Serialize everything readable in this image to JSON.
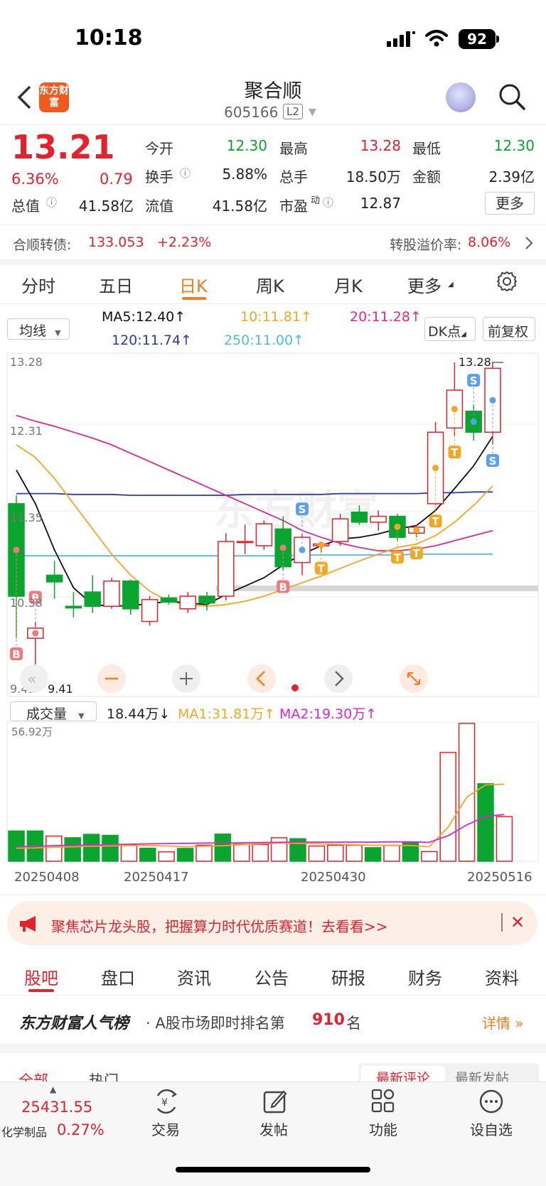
{
  "status": {
    "time": "10:18",
    "battery": "92"
  },
  "header": {
    "logo": "东方财富",
    "name": "聚合顺",
    "code": "605166",
    "level": "L2"
  },
  "quote": {
    "price": "13.21",
    "change_pct": "6.36%",
    "change": "0.79",
    "open_label": "今开",
    "open": "12.30",
    "high_label": "最高",
    "high": "13.28",
    "low_label": "最低",
    "low": "12.30",
    "turnover_label": "换手",
    "turnover": "5.88%",
    "volume_label": "总手",
    "volume": "18.50万",
    "amount_label": "金额",
    "amount": "2.39亿",
    "mktcap_label": "总值",
    "mktcap": "41.58亿",
    "float_label": "流值",
    "float": "41.58亿",
    "pe_label": "市盈",
    "pe_sup": "动",
    "pe": "12.87",
    "more": "更多"
  },
  "bond": {
    "label": "合顺转债:",
    "price": "133.053",
    "change": "+2.23%",
    "premium_label": "转股溢价率:",
    "premium": "8.06%"
  },
  "tabs": [
    "分时",
    "五日",
    "日K",
    "周K",
    "月K",
    "更多"
  ],
  "ma_row": {
    "selector": "均线",
    "ma5": "MA5:12.40↑",
    "ma10": "10:11.81↑",
    "ma20": "20:11.28↑",
    "ma120": "120:11.74↑",
    "ma250": "250:11.00↑",
    "dk": "DK点",
    "fq": "前复权"
  },
  "chart_labels": {
    "hi_axis": "13.28",
    "mid1": "12.31",
    "mid2": "11.35",
    "mid3": "10.38",
    "lo_axis": "9.41",
    "hi_mark": "13.28",
    "lo_mark": "9.41"
  },
  "watermark": "东方财富",
  "chart_data": [
    {
      "type": "candlestick",
      "y_range": [
        9.41,
        13.28
      ],
      "candles": [
        {
          "o": 11.6,
          "h": 11.7,
          "l": 10.0,
          "c": 10.5
        },
        {
          "o": 10.0,
          "h": 10.2,
          "l": 9.41,
          "c": 10.12
        },
        {
          "o": 10.75,
          "h": 10.92,
          "l": 10.47,
          "c": 10.67
        },
        {
          "o": 10.38,
          "h": 10.55,
          "l": 10.25,
          "c": 10.36
        },
        {
          "o": 10.55,
          "h": 10.75,
          "l": 10.3,
          "c": 10.38
        },
        {
          "o": 10.38,
          "h": 10.72,
          "l": 10.35,
          "c": 10.68
        },
        {
          "o": 10.68,
          "h": 10.7,
          "l": 10.28,
          "c": 10.35
        },
        {
          "o": 10.2,
          "h": 10.5,
          "l": 10.15,
          "c": 10.46
        },
        {
          "o": 10.48,
          "h": 10.52,
          "l": 10.4,
          "c": 10.43
        },
        {
          "o": 10.35,
          "h": 10.55,
          "l": 10.3,
          "c": 10.5
        },
        {
          "o": 10.5,
          "h": 10.55,
          "l": 10.33,
          "c": 10.42
        },
        {
          "o": 10.5,
          "h": 11.25,
          "l": 10.45,
          "c": 11.15
        },
        {
          "o": 11.15,
          "h": 11.35,
          "l": 11.0,
          "c": 11.15
        },
        {
          "o": 11.1,
          "h": 11.4,
          "l": 11.05,
          "c": 11.36
        },
        {
          "o": 11.3,
          "h": 11.45,
          "l": 10.8,
          "c": 10.85
        },
        {
          "o": 10.9,
          "h": 11.25,
          "l": 10.75,
          "c": 11.2
        },
        {
          "o": 11.1,
          "h": 11.15,
          "l": 11.02,
          "c": 11.12
        },
        {
          "o": 11.15,
          "h": 11.48,
          "l": 11.1,
          "c": 11.42
        },
        {
          "o": 11.5,
          "h": 11.58,
          "l": 11.35,
          "c": 11.38
        },
        {
          "o": 11.38,
          "h": 11.52,
          "l": 11.28,
          "c": 11.45
        },
        {
          "o": 11.45,
          "h": 11.48,
          "l": 11.15,
          "c": 11.2
        },
        {
          "o": 11.25,
          "h": 11.35,
          "l": 11.2,
          "c": 11.32
        },
        {
          "o": 11.6,
          "h": 12.57,
          "l": 11.58,
          "c": 12.45
        },
        {
          "o": 12.5,
          "h": 13.28,
          "l": 12.4,
          "c": 12.95
        },
        {
          "o": 12.7,
          "h": 12.78,
          "l": 12.35,
          "c": 12.45
        },
        {
          "o": 12.45,
          "h": 13.28,
          "l": 12.3,
          "c": 13.21
        }
      ],
      "ma5": [
        12.0,
        11.6,
        11.05,
        10.6,
        10.4,
        10.38,
        10.39,
        10.41,
        10.44,
        10.42,
        10.4,
        10.52,
        10.62,
        10.72,
        10.87,
        11.0,
        11.1,
        11.18,
        11.2,
        11.24,
        11.3,
        11.34,
        11.52,
        11.78,
        12.05,
        12.4
      ],
      "ma10": [
        12.3,
        12.15,
        11.9,
        11.6,
        11.3,
        11.0,
        10.75,
        10.56,
        10.44,
        10.4,
        10.38,
        10.4,
        10.44,
        10.5,
        10.58,
        10.66,
        10.74,
        10.83,
        10.92,
        11.0,
        11.08,
        11.12,
        11.22,
        11.38,
        11.58,
        11.81
      ],
      "ma20": [
        12.65,
        12.58,
        12.52,
        12.45,
        12.38,
        12.3,
        12.2,
        12.1,
        12.0,
        11.9,
        11.8,
        11.7,
        11.6,
        11.5,
        11.4,
        11.28,
        11.2,
        11.13,
        11.08,
        11.04,
        11.04,
        11.06,
        11.1,
        11.16,
        11.22,
        11.28
      ],
      "ma120": [
        11.72,
        11.72,
        11.72,
        11.71,
        11.71,
        11.71,
        11.7,
        11.7,
        11.7,
        11.7,
        11.7,
        11.7,
        11.71,
        11.71,
        11.71,
        11.71,
        11.71,
        11.72,
        11.72,
        11.72,
        11.72,
        11.72,
        11.73,
        11.73,
        11.74,
        11.74
      ],
      "ma250": [
        10.98,
        10.98,
        10.98,
        10.98,
        10.98,
        10.98,
        10.98,
        10.98,
        10.98,
        10.98,
        10.98,
        10.98,
        10.98,
        10.98,
        10.98,
        10.99,
        10.99,
        10.99,
        10.99,
        10.99,
        10.99,
        11.0,
        11.0,
        11.0,
        11.0,
        11.0
      ],
      "signals": [
        {
          "i": 0,
          "t": "B",
          "side": "low"
        },
        {
          "i": 1,
          "t": "B",
          "side": "high"
        },
        {
          "i": 14,
          "t": "B",
          "side": "low"
        },
        {
          "i": 15,
          "t": "S",
          "side": "high"
        },
        {
          "i": 16,
          "t": "T",
          "side": "low"
        },
        {
          "i": 20,
          "t": "T",
          "side": "low"
        },
        {
          "i": 21,
          "t": "T",
          "side": "low"
        },
        {
          "i": 22,
          "t": "T",
          "side": "low"
        },
        {
          "i": 23,
          "t": "T",
          "side": "low"
        },
        {
          "i": 24,
          "t": "S",
          "side": "high"
        },
        {
          "i": 25,
          "t": "S",
          "side": "low"
        }
      ]
    },
    {
      "type": "bar",
      "ylim": [
        0,
        56.92
      ],
      "unit": "万",
      "volumes": [
        12.5,
        12.5,
        10.4,
        9.7,
        11.1,
        10.7,
        6.9,
        5.4,
        3.9,
        5.3,
        6.6,
        11.2,
        7.0,
        6.9,
        9.7,
        9.3,
        6.3,
        6.6,
        6.6,
        5.6,
        6.6,
        7.7,
        4.0,
        44.9,
        56.92,
        32.0,
        18.44
      ],
      "ma1": [
        5.4,
        5.5,
        5.8,
        6.0,
        6.2,
        6.3,
        6.5,
        6.5,
        6.3,
        6.0,
        6.2,
        6.4,
        6.8,
        7.2,
        7.5,
        7.4,
        7.3,
        7.0,
        6.8,
        6.6,
        6.5,
        6.5,
        6.0,
        14.0,
        26.5,
        31.5,
        31.81
      ],
      "ma2": [
        6.0,
        6.2,
        6.4,
        6.6,
        6.7,
        6.9,
        7.0,
        7.2,
        7.3,
        7.4,
        7.5,
        7.6,
        7.6,
        7.7,
        7.8,
        7.9,
        7.9,
        7.9,
        7.9,
        7.9,
        8.0,
        8.0,
        7.8,
        10.5,
        15.0,
        18.5,
        19.3
      ],
      "x_labels": [
        "20250408",
        "20250417",
        "20250430",
        "20250516"
      ]
    }
  ],
  "volume_row": {
    "selector": "成交量",
    "current": "18.44万↓",
    "ma1": "MA1:31.81万↑",
    "ma2": "MA2:19.30万↑",
    "max_label": "56.92万"
  },
  "banner": {
    "text": "聚焦芯片龙头股，把握算力时代优质赛道！去看看>>"
  },
  "section_tabs": [
    "股吧",
    "盘口",
    "资讯",
    "公告",
    "研报",
    "财务",
    "资料"
  ],
  "popularity": {
    "title": "东方财富人气榜",
    "text_prefix": "· A股市场即时排名第",
    "rank": "910",
    "text_suffix": "名",
    "detail": "详情"
  },
  "sub_tabs": {
    "all": "全部",
    "hot": "热门",
    "latest_comment": "最新评论",
    "latest_post": "最新发帖"
  },
  "bottom_bar": {
    "index_value": "25431.55",
    "index_name": "化学制品",
    "index_change": "0.27%",
    "items": [
      "交易",
      "发帖",
      "功能",
      "设自选"
    ]
  },
  "colors": {
    "up": "#e5212b",
    "down": "#0aa52f",
    "accent": "#f57c20",
    "ma5": "#111111",
    "ma10": "#f5a623",
    "ma20": "#e0288e",
    "ma120": "#2d3aa8",
    "ma250": "#52b8f0"
  }
}
